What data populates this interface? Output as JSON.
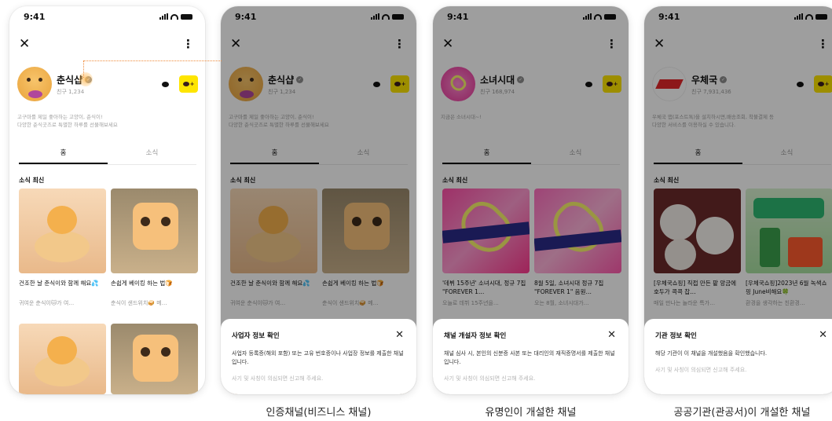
{
  "screens": [
    {
      "time": "9:41",
      "name": "춘식샵",
      "friends": "친구 1,234",
      "desc": [
        "고구마를 제일 좋아하는 고양이, 춘식이!",
        "다양한 춘식굿즈로 특별한 하루를 선물해보세요"
      ],
      "tabs": [
        "홈",
        "소식"
      ],
      "section": "소식 최신",
      "cards": [
        {
          "title": "건조한 날 춘식이와 함께 해요💦",
          "sub": "귀여운 춘식이🐱가 여…"
        },
        {
          "title": "손쉽게 베이킹 하는 법🍞",
          "sub": "춘식이 샌드위치🥪 메…"
        }
      ],
      "caption": ""
    },
    {
      "time": "9:41",
      "name": "춘식샵",
      "friends": "친구 1,234",
      "desc": [
        "고구마를 제일 좋아하는 고양이, 춘식이!",
        "다양한 춘식굿즈로 특별한 하루를 선물해보세요"
      ],
      "tabs": [
        "홈",
        "소식"
      ],
      "section": "소식 최신",
      "cards": [
        {
          "title": "건조한 날 춘식이와 함께 해요💦",
          "sub": "귀여운 춘식이🐱가 여…"
        },
        {
          "title": "손쉽게 베이킹 하는 법🍞",
          "sub": "춘식이 샌드위치🥪 메…"
        }
      ],
      "sheet": {
        "title": "사업자 정보 확인",
        "body": "사업자 등록증(해외 포함) 또는 고유 번호증이나 사업장 정보를 제출한 채널입니다.",
        "foot": "사기 및 사칭이 의심되면 신고해 주세요."
      },
      "caption": "인증채널(비즈니스 채널)"
    },
    {
      "time": "9:41",
      "name": "소녀시대",
      "friends": "친구 168,974",
      "desc": [
        "지금은 소녀시대~!"
      ],
      "tabs": [
        "홈",
        "소식"
      ],
      "section": "소식 최신",
      "cards": [
        {
          "title": "'데뷔 15주년' 소녀시대, 정규 7집 \"FOREVER 1…",
          "sub": "오늘로 데뷔 15주년을…"
        },
        {
          "title": "8월 5일, 소녀시대 정규 7집 \"FOREVER 1\" 음원…",
          "sub": "오는 8월, 소녀시대가…"
        }
      ],
      "sheet": {
        "title": "채널 개설자 정보 확인",
        "body": "채널 심사 시, 본인의 신분증 사본 또는 대리인의 재직증명서를 제출한 채널입니다.",
        "foot": "사기 및 사칭이 의심되면 신고해 주세요."
      },
      "caption": "유명인이 개설한 채널"
    },
    {
      "time": "9:41",
      "name": "우체국",
      "friends": "친구 7,931,436",
      "desc": [
        "우체국 앱(포스트톡)을 설치하시면,배송조회, 착불결제 등",
        "다양한 서비스를 이용하실 수 있습니다."
      ],
      "tabs": [
        "홈",
        "소식"
      ],
      "section": "소식 최신",
      "cards": [
        {
          "title": "[우체국쇼핑] 직접 만든 팥 앙금에 호두가 콕콕 찹…",
          "sub": "매일 만나는 놀라운 특가…"
        },
        {
          "title": "[우체국쇼핑]2023년 6월 녹색쇼핑 June비해요🍀",
          "sub": "환경을 생각하는 친환경…"
        }
      ],
      "sheet": {
        "title": "기관 정보 확인",
        "body": "해당 기관이 이 채널을 개설했음을 확인했습니다.",
        "foot": "사기 및 사칭이 의심되면 신고해 주세요."
      },
      "caption": "공공기관(관공서)이 개설한 채널"
    }
  ],
  "colors": {
    "yellow": "#fee500",
    "overlay": "rgba(0,0,0,0.38)",
    "connector": "#ef8a3a"
  },
  "icons": [
    "close-icon",
    "more-icon",
    "chat-icon",
    "add-channel-icon",
    "verified-badge-icon"
  ]
}
